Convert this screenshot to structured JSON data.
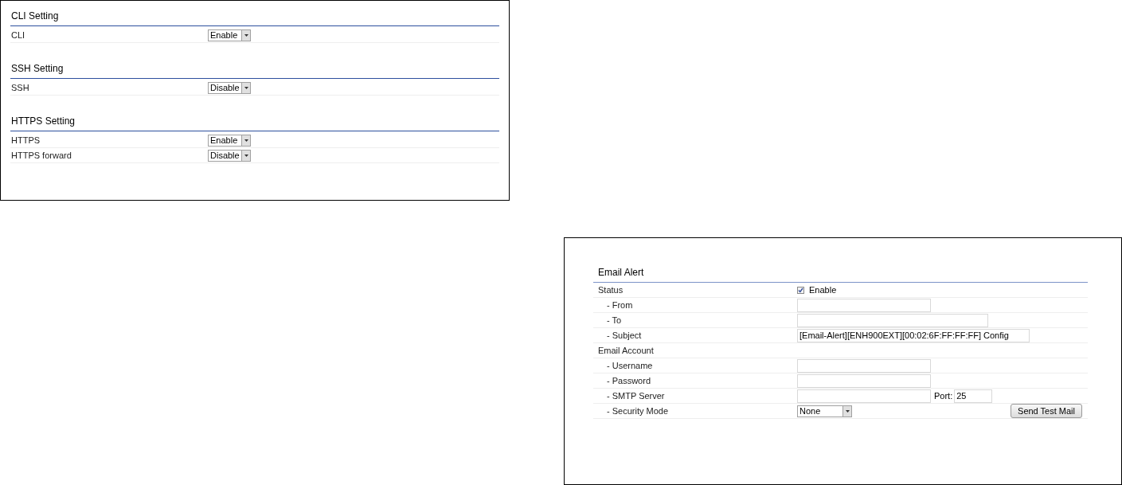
{
  "management_panel": {
    "sections": [
      {
        "title": "CLI Setting",
        "rows": [
          {
            "label": "CLI",
            "value": "Enable"
          }
        ]
      },
      {
        "title": "SSH Setting",
        "rows": [
          {
            "label": "SSH",
            "value": "Disable"
          }
        ]
      },
      {
        "title": "HTTPS Setting",
        "rows": [
          {
            "label": "HTTPS",
            "value": "Enable"
          },
          {
            "label": "HTTPS forward",
            "value": "Disable"
          }
        ]
      }
    ]
  },
  "email_alert": {
    "title": "Email Alert",
    "groups": [
      {
        "kind": "checkbox",
        "label": "Status",
        "checked": true,
        "option": "Enable",
        "children": [
          {
            "kind": "short",
            "label": "- From"
          },
          {
            "kind": "wide",
            "label": "- To"
          },
          {
            "kind": "full",
            "label": "- Subject",
            "value": "[Email-Alert][ENH900EXT][00:02:6F:FF:FF:FF] Config"
          }
        ]
      },
      {
        "kind": "heading",
        "label": "Email Account",
        "children": [
          {
            "kind": "short",
            "label": "- Username"
          },
          {
            "kind": "short",
            "label": "- Password"
          },
          {
            "kind": "server",
            "label": "- SMTP Server",
            "port_label": "Port:",
            "port_value": "25"
          },
          {
            "kind": "select",
            "label": "- Security Mode",
            "value": "None",
            "button": "Send Test Mail"
          }
        ]
      }
    ]
  }
}
